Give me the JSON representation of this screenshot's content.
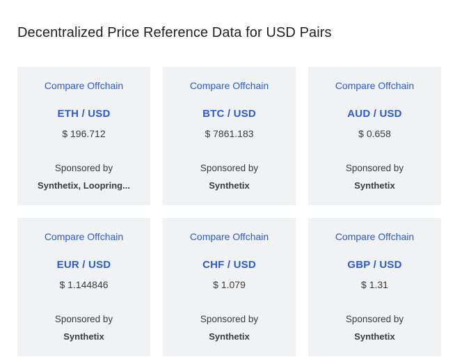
{
  "page": {
    "title": "Decentralized Price Reference Data for USD Pairs"
  },
  "cards": [
    {
      "compare_label": "Compare Offchain",
      "pair": "ETH / USD",
      "price": "$ 196.712",
      "sponsored_label": "Sponsored by",
      "sponsors": "Synthetix, Loopring..."
    },
    {
      "compare_label": "Compare Offchain",
      "pair": "BTC / USD",
      "price": "$ 7861.183",
      "sponsored_label": "Sponsored by",
      "sponsors": "Synthetix"
    },
    {
      "compare_label": "Compare Offchain",
      "pair": "AUD / USD",
      "price": "$ 0.658",
      "sponsored_label": "Sponsored by",
      "sponsors": "Synthetix"
    },
    {
      "compare_label": "Compare Offchain",
      "pair": "EUR / USD",
      "price": "$ 1.144846",
      "sponsored_label": "Sponsored by",
      "sponsors": "Synthetix"
    },
    {
      "compare_label": "Compare Offchain",
      "pair": "CHF / USD",
      "price": "$ 1.079",
      "sponsored_label": "Sponsored by",
      "sponsors": "Synthetix"
    },
    {
      "compare_label": "Compare Offchain",
      "pair": "GBP / USD",
      "price": "$ 1.31",
      "sponsored_label": "Sponsored by",
      "sponsors": "Synthetix"
    }
  ],
  "colors": {
    "link": "#2a5ada",
    "card_background": "#f1f2f4",
    "text": "#3b3b3b"
  }
}
